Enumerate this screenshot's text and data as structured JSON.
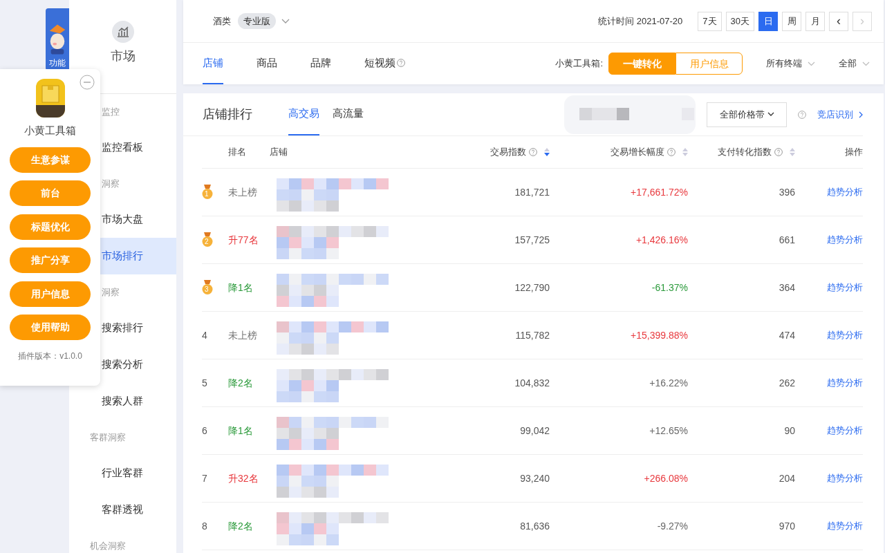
{
  "mascot": {
    "label": "功能"
  },
  "toolbox_popup": {
    "title": "小黄工具箱",
    "buttons": [
      "生意参谋",
      "前台",
      "标题优化",
      "推广分享",
      "用户信息",
      "使用帮助"
    ],
    "version": "插件版本：v1.0.0"
  },
  "sidebar": {
    "title": "市场",
    "groups": [
      {
        "label": "监控",
        "items": [
          {
            "label": "监控看板",
            "selected": false
          }
        ]
      },
      {
        "label": "洞察",
        "items": [
          {
            "label": "市场大盘",
            "selected": false
          },
          {
            "label": "市场排行",
            "selected": true
          }
        ]
      },
      {
        "label": "洞察",
        "items": [
          {
            "label": "搜索排行",
            "selected": false
          },
          {
            "label": "搜索分析",
            "selected": false
          },
          {
            "label": "搜索人群",
            "selected": false
          }
        ]
      },
      {
        "label": "客群洞察",
        "items": [
          {
            "label": "行业客群",
            "selected": false
          },
          {
            "label": "客群透视",
            "selected": false
          }
        ]
      },
      {
        "label": "机会洞察"
      }
    ]
  },
  "top_bar": {
    "category": "酒类",
    "edition": "专业版",
    "stat_time": "统计时间 2021-07-20",
    "periods": [
      {
        "label": "7天",
        "selected": false
      },
      {
        "label": "30天",
        "selected": false
      },
      {
        "label": "日",
        "selected": true
      },
      {
        "label": "周",
        "selected": false
      },
      {
        "label": "月",
        "selected": false
      }
    ],
    "prev": {
      "label": "‹",
      "disabled": false
    },
    "next": {
      "label": "›",
      "disabled": true
    }
  },
  "tabs": [
    {
      "label": "店铺",
      "selected": true,
      "help": false
    },
    {
      "label": "商品",
      "selected": false,
      "help": false
    },
    {
      "label": "品牌",
      "selected": false,
      "help": false
    },
    {
      "label": "短视频",
      "selected": false,
      "help": true
    }
  ],
  "toolbox_bar": {
    "label": "小黄工具箱:",
    "buttons": [
      {
        "label": "一键转化",
        "kind": "filled"
      },
      {
        "label": "用户信息",
        "kind": "outline"
      }
    ]
  },
  "filters": [
    "所有终端",
    "全部"
  ],
  "ranking": {
    "title": "店铺排行",
    "tabs": [
      {
        "label": "高交易",
        "selected": true
      },
      {
        "label": "高流量",
        "selected": false
      }
    ],
    "price_select": "全部价格带",
    "link": "竞店识别",
    "columns": [
      {
        "label": "排名",
        "help": false,
        "sortable": false
      },
      {
        "label": "店铺",
        "help": false,
        "sortable": false
      },
      {
        "label": "交易指数",
        "help": true,
        "sortable": true,
        "sorted": true
      },
      {
        "label": "交易增长幅度",
        "help": true,
        "sortable": true,
        "sorted": false
      },
      {
        "label": "支付转化指数",
        "help": true,
        "sortable": true,
        "sorted": false
      },
      {
        "label": "操作",
        "help": false,
        "sortable": false
      }
    ],
    "rows": [
      {
        "rank": "1",
        "medal": true,
        "change": {
          "text": "未上榜",
          "color": "#777777"
        },
        "index": "181,721",
        "growth": {
          "text": "+17,661.72%",
          "color": "#e8383d"
        },
        "conversion": "396",
        "action": "趋势分析"
      },
      {
        "rank": "2",
        "medal": true,
        "change": {
          "text": "升77名",
          "color": "#e8383d"
        },
        "index": "157,725",
        "growth": {
          "text": "+1,426.16%",
          "color": "#e8383d"
        },
        "conversion": "661",
        "action": "趋势分析"
      },
      {
        "rank": "3",
        "medal": true,
        "change": {
          "text": "降1名",
          "color": "#2b9a3b"
        },
        "index": "122,790",
        "growth": {
          "text": "-61.37%",
          "color": "#2b9a3b"
        },
        "conversion": "364",
        "action": "趋势分析"
      },
      {
        "rank": "4",
        "medal": false,
        "change": {
          "text": "未上榜",
          "color": "#777777"
        },
        "index": "115,782",
        "growth": {
          "text": "+15,399.88%",
          "color": "#e8383d"
        },
        "conversion": "474",
        "action": "趋势分析"
      },
      {
        "rank": "5",
        "medal": false,
        "change": {
          "text": "降2名",
          "color": "#2b9a3b"
        },
        "index": "104,832",
        "growth": {
          "text": "+16.22%",
          "color": "#666666"
        },
        "conversion": "262",
        "action": "趋势分析"
      },
      {
        "rank": "6",
        "medal": false,
        "change": {
          "text": "降1名",
          "color": "#2b9a3b"
        },
        "index": "99,042",
        "growth": {
          "text": "+12.65%",
          "color": "#666666"
        },
        "conversion": "90",
        "action": "趋势分析"
      },
      {
        "rank": "7",
        "medal": false,
        "change": {
          "text": "升32名",
          "color": "#e8383d"
        },
        "index": "93,240",
        "growth": {
          "text": "+266.08%",
          "color": "#e8383d"
        },
        "conversion": "204",
        "action": "趋势分析"
      },
      {
        "rank": "8",
        "medal": false,
        "change": {
          "text": "降2名",
          "color": "#2b9a3b"
        },
        "index": "81,636",
        "growth": {
          "text": "-9.27%",
          "color": "#666666"
        },
        "conversion": "970",
        "action": "趋势分析"
      }
    ]
  }
}
